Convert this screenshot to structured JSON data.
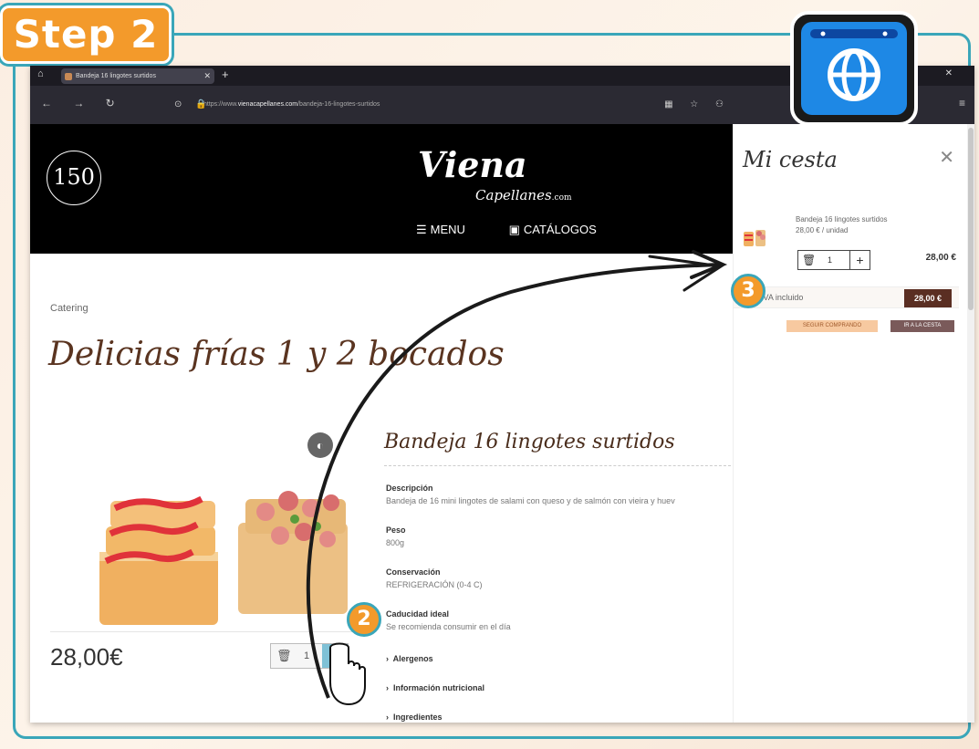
{
  "step_badge": "Step 2",
  "browser": {
    "tab_title": "Bandeja 16 lingotes surtidos",
    "url_prefix": "https://www.",
    "url_domain": "vienacapellanes.com",
    "url_path": "/bandeja-16-lingotes-surtidos"
  },
  "site": {
    "logo_badge": "150",
    "brand": "Viena",
    "brand_sub": "Capellanes",
    "brand_tld": ".com",
    "nav": {
      "menu": "MENU",
      "catalogs": "CATÁLOGOS"
    }
  },
  "page": {
    "breadcrumb": "Catering",
    "title": "Delicias frías 1 y 2 bocados"
  },
  "product": {
    "price": "28,00€",
    "qty": "1",
    "title": "Bandeja 16 lingotes surtidos",
    "specs": [
      {
        "label": "Descripción",
        "value": "Bandeja de 16 mini lingotes de salami con queso y de salmón con vieira y huev"
      },
      {
        "label": "Peso",
        "value": "800g"
      },
      {
        "label": "Conservación",
        "value": "REFRIGERACIÓN (0-4 C)"
      },
      {
        "label": "Caducidad ideal",
        "value": "Se recomienda consumir en el día"
      }
    ],
    "accordions": [
      "Alergenos",
      "Información nutricional",
      "Ingredientes"
    ]
  },
  "cart": {
    "title": "Mi cesta",
    "item_name": "Bandeja 16 lingotes surtidos",
    "item_unit": "28,00 € / unidad",
    "item_qty": "1",
    "item_price": "28,00 €",
    "total_label": "IVA incluido",
    "total_value": "28,00 €",
    "btn_continue": "SEGUIR COMPRANDO",
    "btn_cart": "IR A LA CESTA"
  },
  "markers": {
    "two": "2",
    "three": "3"
  },
  "colors": {
    "accent_orange": "#f39a2b",
    "frame_teal": "#3aa6b9",
    "brand_brown": "#5a2e22",
    "icon_blue": "#1e88e5"
  }
}
